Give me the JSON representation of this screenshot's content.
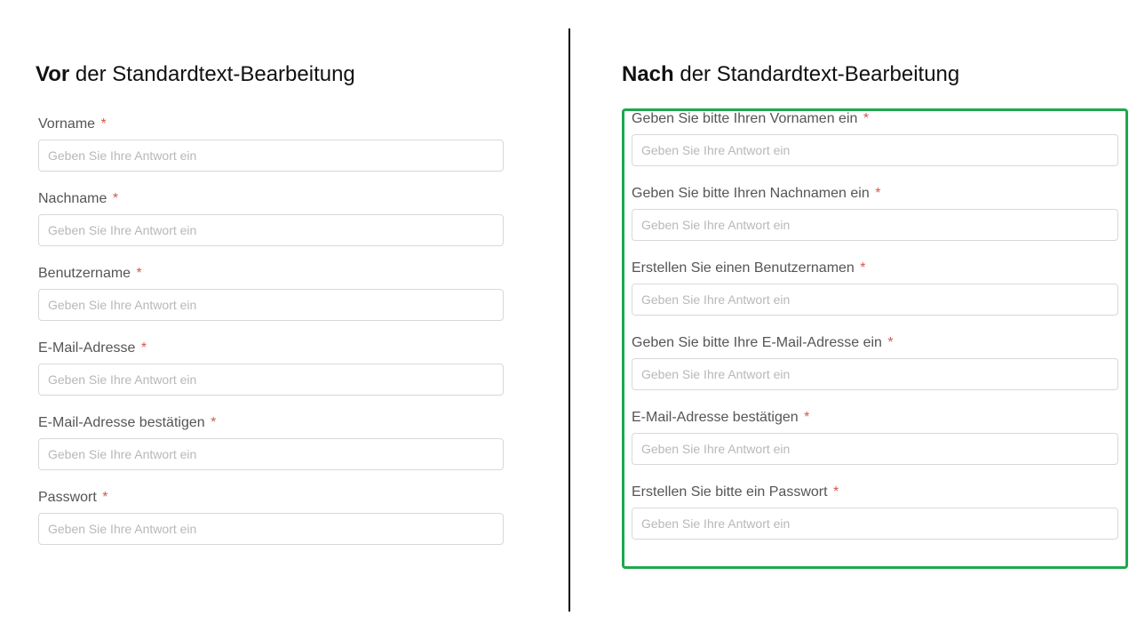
{
  "placeholder": "Geben Sie Ihre Antwort ein",
  "required_mark": "*",
  "before": {
    "heading_bold": "Vor ",
    "heading_rest": "der Standardtext-Bearbeitung",
    "fields": [
      {
        "label": "Vorname"
      },
      {
        "label": "Nachname"
      },
      {
        "label": "Benutzername"
      },
      {
        "label": "E-Mail-Adresse"
      },
      {
        "label": "E-Mail-Adresse bestätigen"
      },
      {
        "label": "Passwort"
      }
    ]
  },
  "after": {
    "heading_bold": "Nach ",
    "heading_rest": "der Standardtext-Bearbeitung",
    "fields": [
      {
        "label": "Geben Sie bitte Ihren Vornamen ein"
      },
      {
        "label": "Geben Sie bitte Ihren Nachnamen ein"
      },
      {
        "label": "Erstellen Sie einen Benutzernamen"
      },
      {
        "label": "Geben Sie bitte Ihre E-Mail-Adresse ein"
      },
      {
        "label": "E-Mail-Adresse bestätigen"
      },
      {
        "label": "Erstellen Sie bitte ein Passwort"
      }
    ]
  }
}
